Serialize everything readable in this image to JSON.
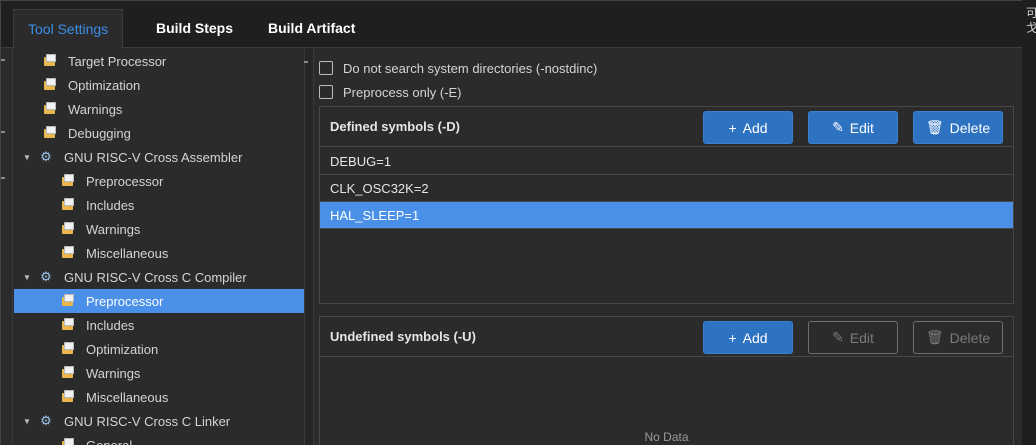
{
  "tabs": [
    {
      "label": "Tool Settings",
      "active": true
    },
    {
      "label": "Build Steps",
      "active": false
    },
    {
      "label": "Build Artifact",
      "active": false
    }
  ],
  "edge_glyphs": [
    "可",
    "戈"
  ],
  "tree": [
    {
      "label": "Target Processor",
      "level": 1,
      "icon": "folder-icon"
    },
    {
      "label": "Optimization",
      "level": 1,
      "icon": "folder-icon"
    },
    {
      "label": "Warnings",
      "level": 1,
      "icon": "folder-icon"
    },
    {
      "label": "Debugging",
      "level": 1,
      "icon": "folder-icon"
    },
    {
      "label": "GNU RISC-V Cross Assembler",
      "level": 0,
      "icon": "gear-icon",
      "expanded": true
    },
    {
      "label": "Preprocessor",
      "level": 2,
      "icon": "folder-icon"
    },
    {
      "label": "Includes",
      "level": 2,
      "icon": "folder-icon"
    },
    {
      "label": "Warnings",
      "level": 2,
      "icon": "folder-icon"
    },
    {
      "label": "Miscellaneous",
      "level": 2,
      "icon": "folder-icon"
    },
    {
      "label": "GNU RISC-V Cross C Compiler",
      "level": 0,
      "icon": "gear-icon",
      "expanded": true
    },
    {
      "label": "Preprocessor",
      "level": 2,
      "icon": "folder-icon",
      "selected": true
    },
    {
      "label": "Includes",
      "level": 2,
      "icon": "folder-icon"
    },
    {
      "label": "Optimization",
      "level": 2,
      "icon": "folder-icon"
    },
    {
      "label": "Warnings",
      "level": 2,
      "icon": "folder-icon"
    },
    {
      "label": "Miscellaneous",
      "level": 2,
      "icon": "folder-icon"
    },
    {
      "label": "GNU RISC-V Cross C Linker",
      "level": 0,
      "icon": "gear-icon",
      "expanded": true
    },
    {
      "label": "General",
      "level": 2,
      "icon": "folder-icon"
    }
  ],
  "options": {
    "nostdinc_label": "Do not search system directories (-nostdinc)",
    "nostdinc_checked": false,
    "preprocess_only_label": "Preprocess only (-E)",
    "preprocess_only_checked": false
  },
  "defined": {
    "title": "Defined symbols (-D)",
    "add_label": "Add",
    "edit_label": "Edit",
    "delete_label": "Delete",
    "items": [
      {
        "value": "DEBUG=1",
        "selected": false
      },
      {
        "value": "CLK_OSC32K=2",
        "selected": false
      },
      {
        "value": "HAL_SLEEP=1",
        "selected": true
      }
    ]
  },
  "undefined": {
    "title": "Undefined symbols (-U)",
    "add_label": "Add",
    "edit_label": "Edit",
    "delete_label": "Delete",
    "edit_enabled": false,
    "delete_enabled": false,
    "empty_text": "No Data"
  },
  "colors": {
    "accent": "#4a90e8",
    "button": "#2e72c2",
    "active_tab_text": "#3b8eea"
  }
}
